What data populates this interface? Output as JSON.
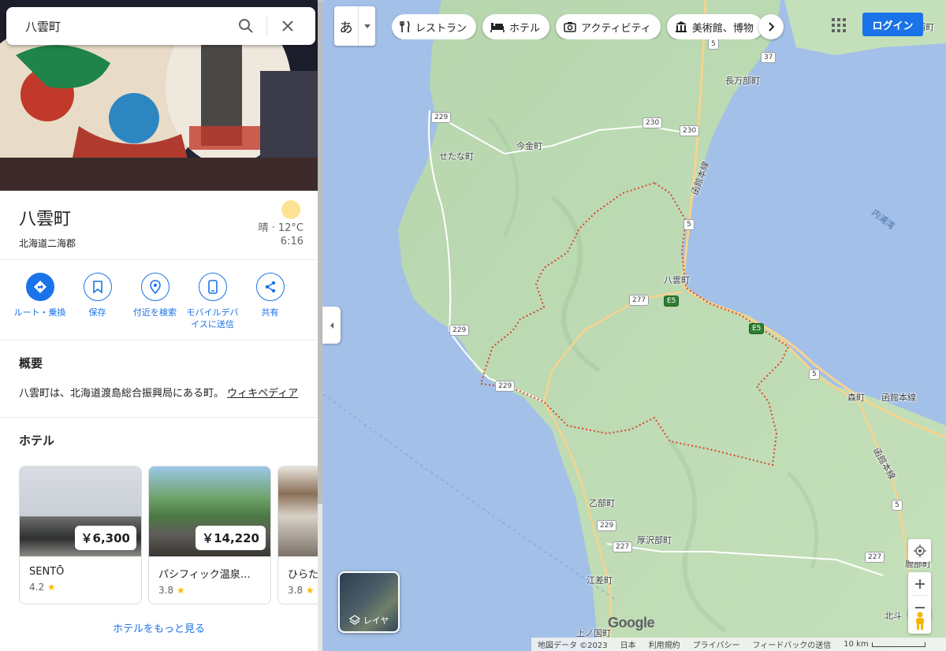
{
  "search": {
    "value": "八雲町"
  },
  "place": {
    "title": "八雲町",
    "subtitle": "北海道二海郡",
    "weather": {
      "condition_temp": "晴 · 12°C",
      "time": "6:16"
    }
  },
  "actions": [
    {
      "label": "ルート・乗換",
      "icon": "directions-icon"
    },
    {
      "label": "保存",
      "icon": "bookmark-icon"
    },
    {
      "label": "付近を検索",
      "icon": "nearby-icon"
    },
    {
      "label": "モバイルデバイスに送信",
      "icon": "phone-icon"
    },
    {
      "label": "共有",
      "icon": "share-icon"
    }
  ],
  "summary": {
    "title": "概要",
    "text": "八雲町は、北海道渡島総合振興局にある町。",
    "link": "ウィキペディア"
  },
  "hotels": {
    "title": "ホテル",
    "items": [
      {
        "name": "SENTŌ",
        "price": "￥6,300",
        "rating": "4.2"
      },
      {
        "name": "パシフィック温泉…",
        "price": "￥14,220",
        "rating": "3.8"
      },
      {
        "name": "ひらた",
        "price": "",
        "rating": "3.8"
      }
    ],
    "more": "ホテルをもっと見る",
    "star": "★"
  },
  "map": {
    "ime_char": "あ",
    "chips": [
      "レストラン",
      "ホテル",
      "アクティビティ",
      "美術館、博物"
    ],
    "login": "ログイン",
    "layers_label": "レイヤ",
    "google_logo": "Google",
    "labels": {
      "nagamanbe": "長万部町",
      "setana": "せたな町",
      "imakane": "今金町",
      "yakumo": "八雲町",
      "mori": "森町",
      "otobe": "乙部町",
      "assabu": "厚沢部町",
      "esashi": "江差町",
      "kaminokuni": "上ノ国町",
      "hokuto": "北斗",
      "shikabe": "鹿部町",
      "toyoura": "豊浦町",
      "uchiura": "内浦湾",
      "hakodate_line_1": "函館本線",
      "hakodate_line_2": "函館本線",
      "hakodate_line_3": "函館本線"
    },
    "shields": [
      "229",
      "229",
      "229",
      "230",
      "230",
      "5",
      "5",
      "5",
      "5",
      "37",
      "277",
      "E5",
      "E5",
      "227",
      "227",
      "229"
    ]
  },
  "footer": {
    "map_data": "地図データ ©2023",
    "country": "日本",
    "terms": "利用規約",
    "privacy": "プライバシー",
    "feedback": "フィードバックの送信",
    "scale": "10 km"
  },
  "colors": {
    "accent": "#1a73e8",
    "water": "#a3c0e8",
    "land": "#b9d8b0",
    "border": "#d9462c",
    "road": "#f6d38d",
    "star": "#fbbc04"
  }
}
